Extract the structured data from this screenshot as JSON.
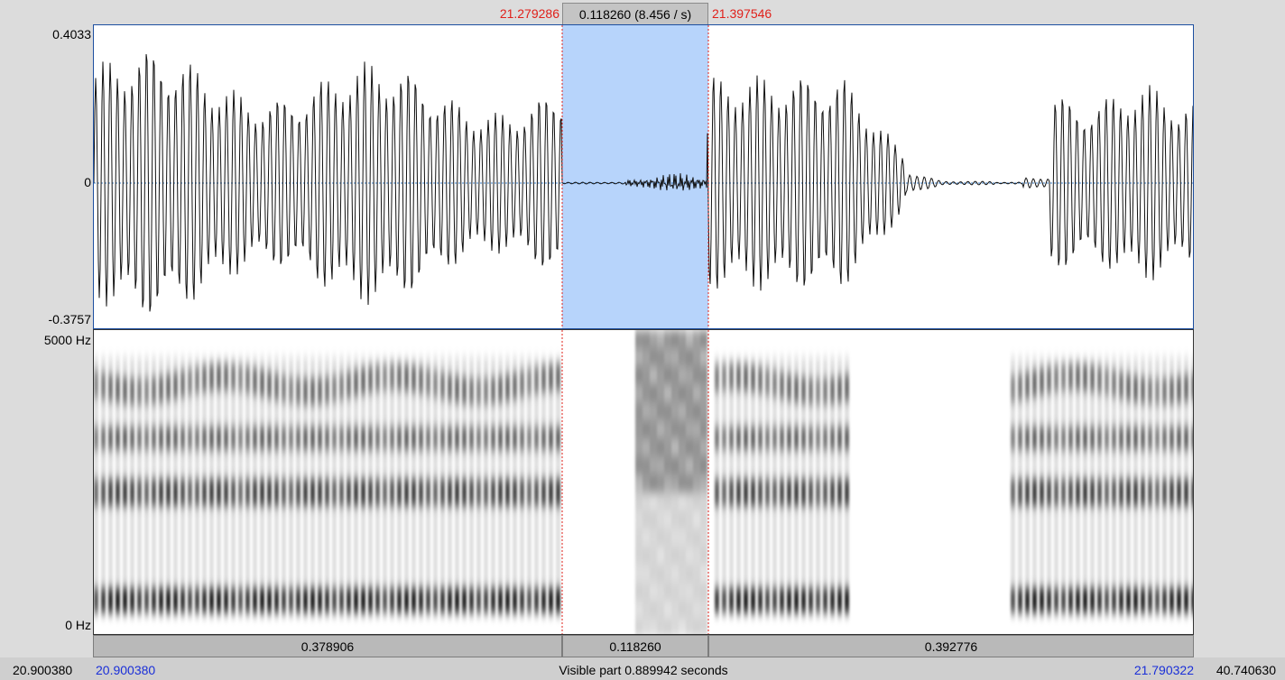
{
  "selection": {
    "start": "21.279286",
    "end": "21.397546",
    "duration_label": "0.118260 (8.456 / s)"
  },
  "waveform": {
    "y_max_label": "0.4033",
    "y_zero_label": "0",
    "y_min_label": "-0.3757"
  },
  "spectrogram": {
    "top_label": "5000 Hz",
    "bottom_label": "0 Hz"
  },
  "segments": {
    "before": "0.378906",
    "selected": "0.118260",
    "after": "0.392776"
  },
  "footer": {
    "total_start": "20.900380",
    "visible_start": "20.900380",
    "visible_label": "Visible part 0.889942 seconds",
    "visible_end": "21.790322",
    "total_end": "40.740630"
  },
  "colors": {
    "selection_fill": "#b7d4fb",
    "selection_marker": "#e0201a",
    "panel_border": "#1d4fa0",
    "time_blue": "#1a2fd8"
  }
}
